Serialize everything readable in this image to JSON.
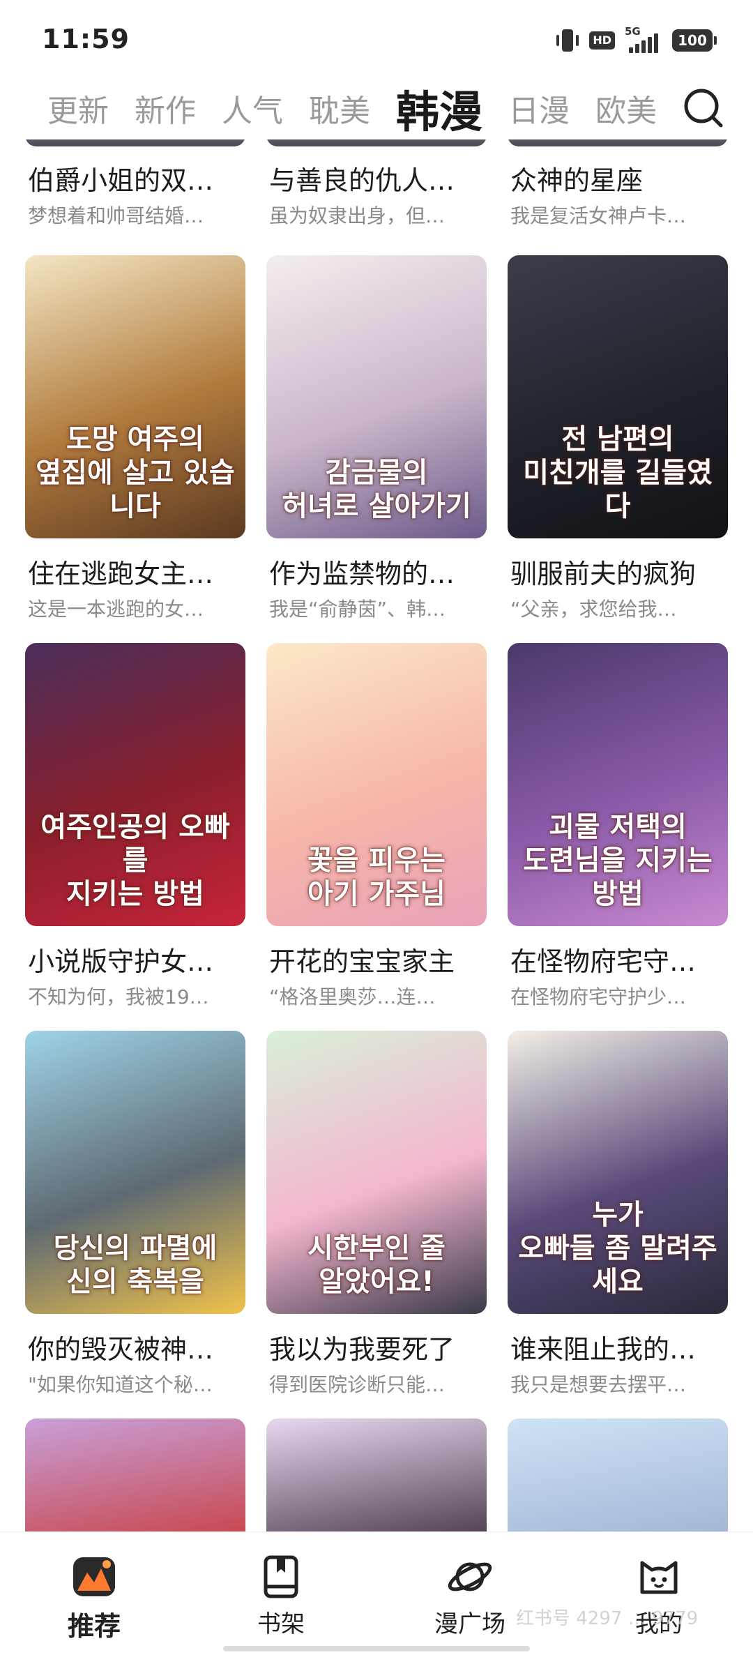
{
  "status_bar": {
    "time": "11:59",
    "hd": "HD",
    "network": "5G",
    "battery": "100"
  },
  "tabs": [
    {
      "label": "更新",
      "active": false
    },
    {
      "label": "新作",
      "active": false
    },
    {
      "label": "人气",
      "active": false
    },
    {
      "label": "耽美",
      "active": false
    },
    {
      "label": "韩漫",
      "active": true
    },
    {
      "label": "日漫",
      "active": false
    },
    {
      "label": "欧美",
      "active": false
    }
  ],
  "search_icon": "search-icon",
  "partial_row": [
    {
      "title": "伯爵小姐的双…",
      "desc": "梦想着和帅哥结婚…"
    },
    {
      "title": "与善良的仇人…",
      "desc": "虽为奴隶出身，但…"
    },
    {
      "title": "众神的星座",
      "desc": "我是复活女神卢卡…"
    }
  ],
  "comics": [
    {
      "title": "住在逃跑女主…",
      "desc": "这是一本逃跑的女…",
      "cover_text": "도망 여주의\n옆집에 살고 있습니다",
      "colors": [
        "#f3e6c4",
        "#b07a3c",
        "#5b3a22"
      ]
    },
    {
      "title": "作为监禁物的…",
      "desc": "我是“俞静茵”、韩…",
      "cover_text": "감금물의\n허녀로 살아가기",
      "colors": [
        "#f4eef0",
        "#c9b6c9",
        "#6c5a8a"
      ]
    },
    {
      "title": "驯服前夫的疯狗",
      "desc": "“父亲，求您给我…",
      "cover_text": "전 남편의\n미친개를 길들였다",
      "colors": [
        "#3b3d4a",
        "#20222b",
        "#111216"
      ]
    },
    {
      "title": "小说版守护女…",
      "desc": "不知为何，我被19…",
      "cover_text": "여주인공의 오빠를\n지키는 방법",
      "colors": [
        "#4a2f5a",
        "#8c1f2c",
        "#c8243a"
      ]
    },
    {
      "title": "开花的宝宝家主",
      "desc": "“格洛里奥莎…连…",
      "cover_text": "꽃을 피우는\n아기 가주님",
      "colors": [
        "#fbe9c8",
        "#f6b6a8",
        "#e8a2b8"
      ]
    },
    {
      "title": "在怪物府宅守…",
      "desc": "在怪物府宅守护少…",
      "cover_text": "괴물 저택의\n도련님을 지키는 방법",
      "colors": [
        "#4a3a6a",
        "#8a5aa8",
        "#c88ad0"
      ]
    },
    {
      "title": "你的毁灭被神…",
      "desc": "\"如果你知道这个秘…",
      "cover_text": "당신의 파멸에\n신의 축복을",
      "colors": [
        "#9fd3e8",
        "#5e6a72",
        "#f0c24a"
      ]
    },
    {
      "title": "我以为我要死了",
      "desc": "得到医院诊断只能…",
      "cover_text": "시한부인 줄\n알았어요!",
      "colors": [
        "#d8f0d8",
        "#f3b6cf",
        "#3a3a48"
      ]
    },
    {
      "title": "谁来阻止我的…",
      "desc": "我只是想要去摆平…",
      "cover_text": "누가\n오빠들 좀 말려주세요",
      "colors": [
        "#f3efe6",
        "#5a4a7a",
        "#2a2a3a"
      ]
    }
  ],
  "bottom_row_colors": [
    [
      "#c8a0d8",
      "#c83a3a"
    ],
    [
      "#e8d8f0",
      "#3a2a3a"
    ],
    [
      "#cfe3f5",
      "#9ab0d0"
    ]
  ],
  "nav": [
    {
      "label": "推荐",
      "icon": "recommend-icon",
      "active": true
    },
    {
      "label": "书架",
      "icon": "bookshelf-icon",
      "active": false
    },
    {
      "label": "漫广场",
      "icon": "planet-icon",
      "active": false
    },
    {
      "label": "我的",
      "icon": "cat-profile-icon",
      "active": false
    }
  ],
  "watermark": "红书号 4297 … 9779"
}
